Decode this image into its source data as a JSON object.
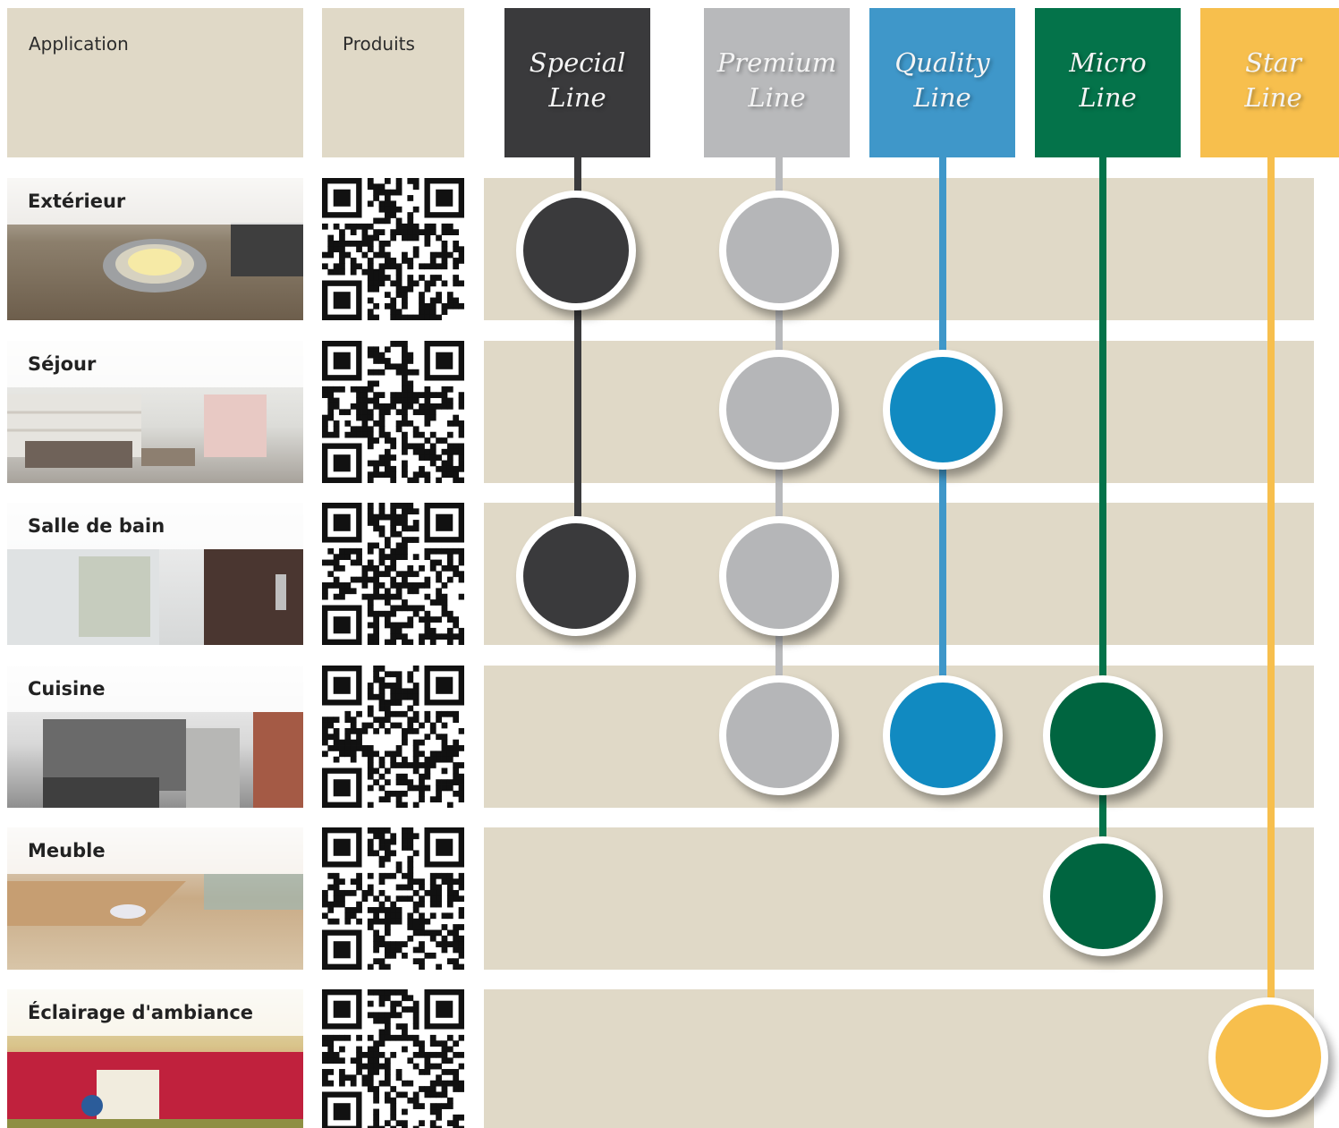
{
  "header": {
    "application_label": "Application",
    "products_label": "Produits"
  },
  "lines": [
    {
      "id": "special",
      "word1": "Special",
      "word2": "Line",
      "color": "#3a3a3c"
    },
    {
      "id": "premium",
      "word1": "Premium",
      "word2": "Line",
      "color": "#b8b9bb"
    },
    {
      "id": "quality",
      "word1": "Quality",
      "word2": "Line",
      "color": "#3f97c9"
    },
    {
      "id": "micro",
      "word1": "Micro",
      "word2": "Line",
      "color": "#04734a"
    },
    {
      "id": "star",
      "word1": "Star",
      "word2": "Line",
      "color": "#f7bf4d"
    }
  ],
  "applications": [
    {
      "label": "Extérieur",
      "lines": [
        "special",
        "premium"
      ]
    },
    {
      "label": "Séjour",
      "lines": [
        "premium",
        "quality"
      ]
    },
    {
      "label": "Salle de bain",
      "lines": [
        "special",
        "premium"
      ]
    },
    {
      "label": "Cuisine",
      "lines": [
        "premium",
        "quality",
        "micro"
      ]
    },
    {
      "label": "Meuble",
      "lines": [
        "micro"
      ]
    },
    {
      "label": "Éclairage d'ambiance",
      "lines": [
        "star"
      ]
    }
  ],
  "colors": {
    "band": "#e0d9c7",
    "dot_special": "#3a3a3c",
    "dot_premium": "#b5b6b8",
    "dot_quality": "#118ac1",
    "dot_micro": "#006540",
    "dot_star": "#f7bf4d"
  }
}
